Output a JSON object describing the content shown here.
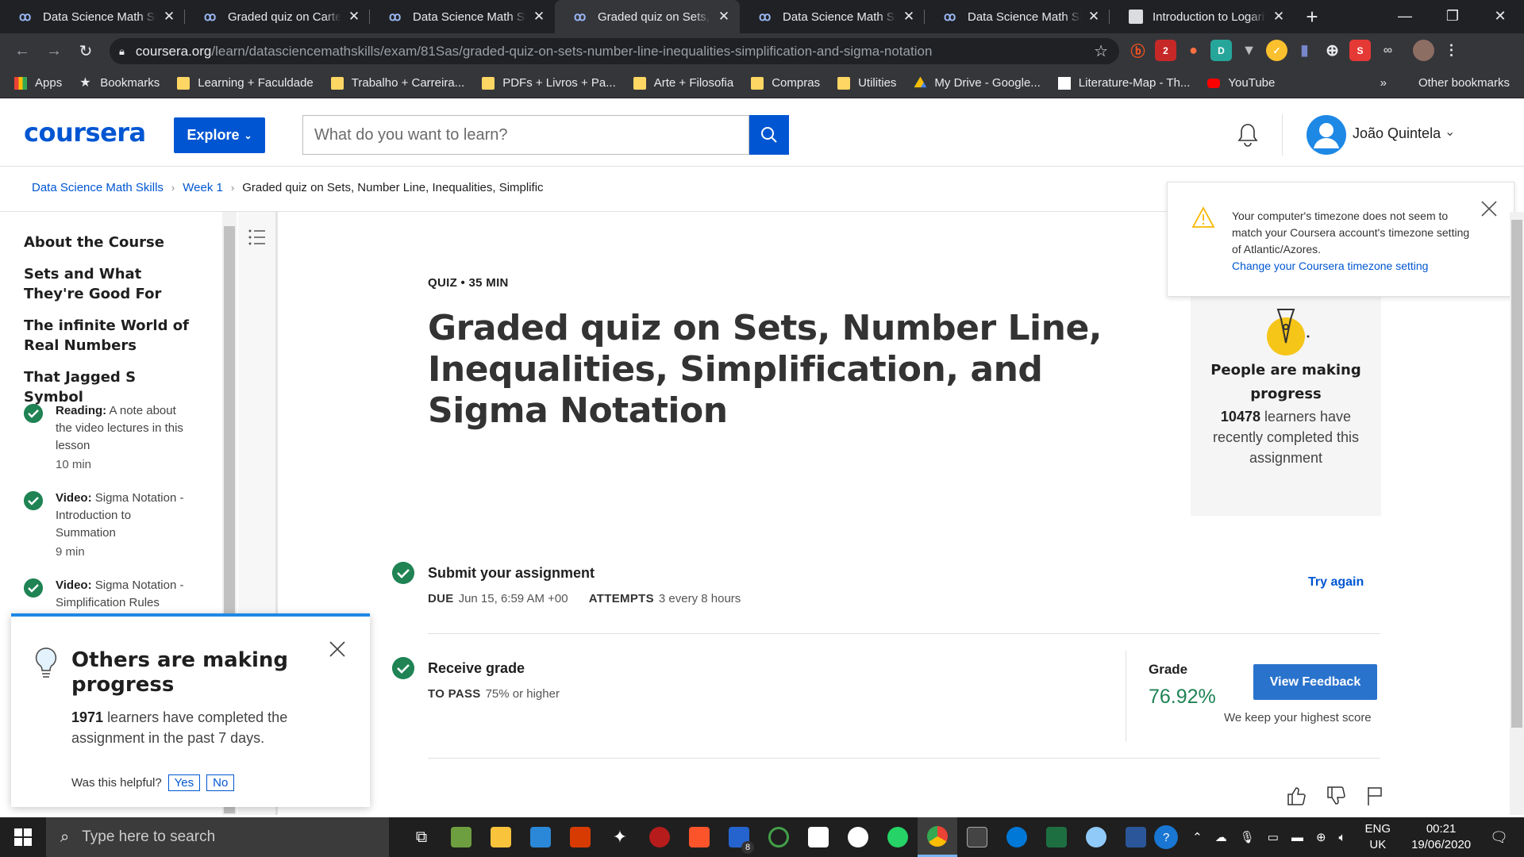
{
  "browser": {
    "tabs": [
      {
        "label": "Data Science Math Skills",
        "active": false
      },
      {
        "label": "Graded quiz on Cartesian",
        "active": false
      },
      {
        "label": "Data Science Math Skills",
        "active": false
      },
      {
        "label": "Graded quiz on Sets, Number",
        "active": true
      },
      {
        "label": "Data Science Math Skills",
        "active": false
      },
      {
        "label": "Data Science Math Skills",
        "active": false
      },
      {
        "label": "Introduction to Logarithms",
        "active": false
      }
    ],
    "url_host": "coursera.org",
    "url_path": "/learn/datasciencemathskills/exam/81Sas/graded-quiz-on-sets-number-line-inequalities-simplification-and-sigma-notation",
    "bookmarks": [
      {
        "label": "Apps",
        "icon": "apps-grid-icon"
      },
      {
        "label": "Bookmarks",
        "icon": "star-icon"
      },
      {
        "label": "Learning + Faculdade",
        "icon": "folder-icon"
      },
      {
        "label": "Trabalho + Carreira...",
        "icon": "folder-icon"
      },
      {
        "label": "PDFs + Livros + Pa...",
        "icon": "folder-icon"
      },
      {
        "label": "Arte + Filosofia",
        "icon": "folder-icon"
      },
      {
        "label": "Compras",
        "icon": "folder-icon"
      },
      {
        "label": "Utilities",
        "icon": "folder-icon"
      },
      {
        "label": "My Drive - Google...",
        "icon": "google-drive-icon"
      },
      {
        "label": "Literature-Map - Th...",
        "icon": "literature-map-icon"
      },
      {
        "label": "YouTube",
        "icon": "youtube-icon"
      }
    ],
    "bookmarks_overflow": "»",
    "other_bookmarks": "Other bookmarks"
  },
  "header": {
    "logo": "coursera",
    "explore_label": "Explore",
    "search_placeholder": "What do you want to learn?",
    "user_name": "João Quintela"
  },
  "breadcrumb": {
    "course": "Data Science Math Skills",
    "week": "Week 1",
    "current": "Graded quiz on Sets, Number Line, Inequalities, Simplific"
  },
  "sidebar": {
    "sections": [
      "About the Course",
      "Sets and What They're Good For",
      "The infinite World of Real Numbers",
      "That Jagged S Symbol"
    ],
    "items": [
      {
        "type": "Reading:",
        "title": "A note about the video lectures in this lesson",
        "duration": "10 min"
      },
      {
        "type": "Video:",
        "title": "Sigma Notation - Introduction to Summation",
        "duration": "9 min"
      },
      {
        "type": "Video:",
        "title": "Sigma Notation - Simplification Rules",
        "duration": ""
      }
    ]
  },
  "main": {
    "eyebrow": "QUIZ • 35 MIN",
    "title": "Graded quiz on Sets, Number Line, Inequalities, Simplification, and Sigma Notation",
    "submit": {
      "title": "Submit your assignment",
      "due_label": "DUE",
      "due_value": "Jun 15, 6:59 AM +00",
      "attempts_label": "ATTEMPTS",
      "attempts_value": "3 every 8 hours",
      "try_again": "Try again"
    },
    "receive": {
      "title": "Receive grade",
      "pass_label": "TO PASS",
      "pass_value": "75% or higher",
      "grade_label": "Grade",
      "grade_value": "76.92%",
      "view_feedback": "View Feedback",
      "keep_note": "We keep your highest score"
    }
  },
  "progress_card": {
    "title": "People are making progress",
    "count": "10478",
    "text": "learners have recently completed this assignment"
  },
  "timezone_notice": {
    "text": "Your computer's timezone does not seem to match your Coursera account's timezone setting of Atlantic/Azores.",
    "link": "Change your Coursera timezone setting"
  },
  "popup": {
    "title": "Others are making progress",
    "count": "1971",
    "text": "learners have completed the assignment in the past 7 days.",
    "helpful_q": "Was this helpful?",
    "yes": "Yes",
    "no": "No"
  },
  "taskbar": {
    "search_placeholder": "Type here to search",
    "lang_top": "ENG",
    "lang_bottom": "UK",
    "time": "00:21",
    "date": "19/06/2020",
    "todo_badge": "8"
  },
  "colors": {
    "brand_blue": "#0056d2",
    "success_green": "#1f8354",
    "warning_yellow": "#f5b800"
  }
}
